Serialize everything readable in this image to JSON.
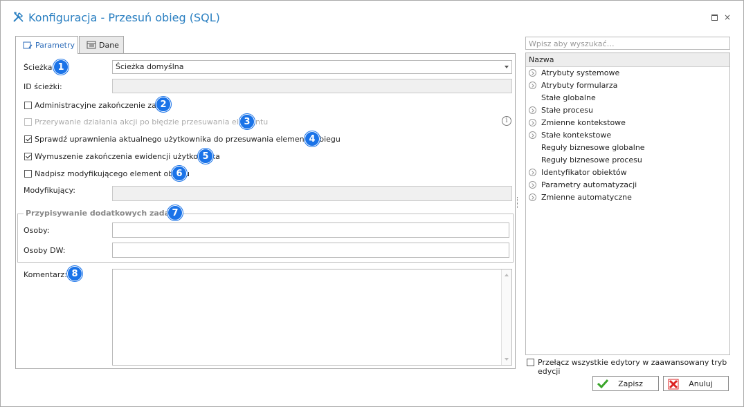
{
  "window": {
    "title": "Konfiguracja - Przesuń obieg (SQL)",
    "maximize_icon": "maximize-icon",
    "close_glyph": "×"
  },
  "tabs": [
    {
      "label": "Parametry",
      "icon": "parameters-icon",
      "active": true
    },
    {
      "label": "Dane",
      "icon": "data-icon",
      "active": false
    }
  ],
  "form": {
    "path_label": "Ścieżka:",
    "path_value": "Ścieżka domyślna",
    "path_id_label": "ID ścieżki:",
    "path_id_value": "",
    "checkboxes": [
      {
        "label": "Administracyjne zakończenie zadań",
        "checked": false,
        "disabled": false
      },
      {
        "label": "Przerywanie działania akcji po błędzie przesuwania elementu",
        "checked": false,
        "disabled": true
      },
      {
        "label": "Sprawdź uprawnienia aktualnego użytkownika do przesuwania elementu obiegu",
        "checked": true,
        "disabled": false
      },
      {
        "label": "Wymuszenie zakończenia ewidencji użytkownika",
        "checked": true,
        "disabled": false
      },
      {
        "label": "Nadpisz modyfikującego element obiegu",
        "checked": false,
        "disabled": false
      }
    ],
    "modifier_label": "Modyfikujący:",
    "modifier_value": "",
    "group_title": "Przypisywanie dodatkowych zadań",
    "persons_label": "Osoby:",
    "persons_value": "",
    "persons_cc_label": "Osoby DW:",
    "persons_cc_value": "",
    "comment_label": "Komentarz:",
    "comment_value": "",
    "info_glyph": "i"
  },
  "badges": [
    "1",
    "2",
    "3",
    "4",
    "5",
    "6",
    "7",
    "8"
  ],
  "accent_color": "#1a73e8",
  "title_color": "#2a7fc1",
  "right_panel": {
    "search_placeholder": "Wpisz aby wyszukać…",
    "column_header": "Nazwa",
    "items": [
      {
        "label": "Atrybuty systemowe",
        "expandable": true
      },
      {
        "label": "Atrybuty formularza",
        "expandable": true
      },
      {
        "label": "Stałe globalne",
        "expandable": false
      },
      {
        "label": "Stałe procesu",
        "expandable": true
      },
      {
        "label": "Zmienne kontekstowe",
        "expandable": true
      },
      {
        "label": "Stałe kontekstowe",
        "expandable": true
      },
      {
        "label": "Reguły biznesowe globalne",
        "expandable": false
      },
      {
        "label": "Reguły biznesowe procesu",
        "expandable": false
      },
      {
        "label": "Identyfikator obiektów",
        "expandable": true
      },
      {
        "label": "Parametry automatyzacji",
        "expandable": true
      },
      {
        "label": "Zmienne automatyczne",
        "expandable": true
      }
    ],
    "advanced_toggle_label": "Przełącz wszystkie edytory w zaawansowany tryb edycji"
  },
  "buttons": {
    "save_label": "Zapisz",
    "cancel_label": "Anuluj"
  }
}
